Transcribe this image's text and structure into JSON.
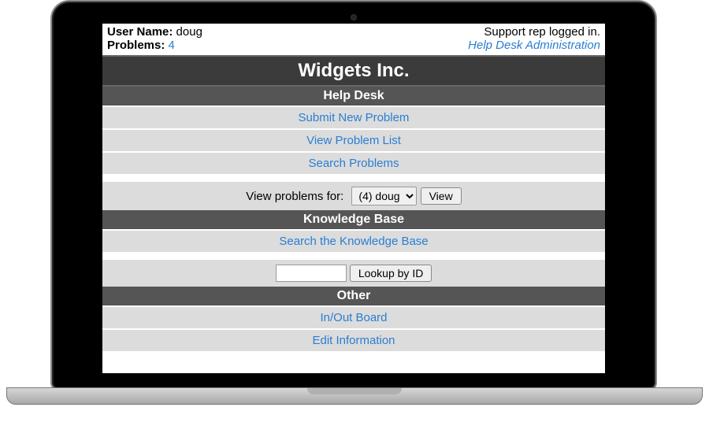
{
  "header": {
    "user_name_label": "User Name:",
    "user_name_value": "doug",
    "problems_label": "Problems:",
    "problems_count": "4",
    "status_text": "Support rep logged in.",
    "admin_link": "Help Desk Administration"
  },
  "title": "Widgets Inc.",
  "sections": {
    "help_desk": {
      "heading": "Help Desk",
      "links": {
        "submit": "Submit New Problem",
        "view_list": "View Problem List",
        "search": "Search Problems"
      },
      "filter": {
        "label": "View problems for:",
        "selected": "(4) doug",
        "button": "View"
      }
    },
    "kb": {
      "heading": "Knowledge Base",
      "search_link": "Search the Knowledge Base",
      "lookup_button": "Lookup by ID"
    },
    "other": {
      "heading": "Other",
      "inout": "In/Out Board",
      "edit": "Edit Information"
    }
  }
}
